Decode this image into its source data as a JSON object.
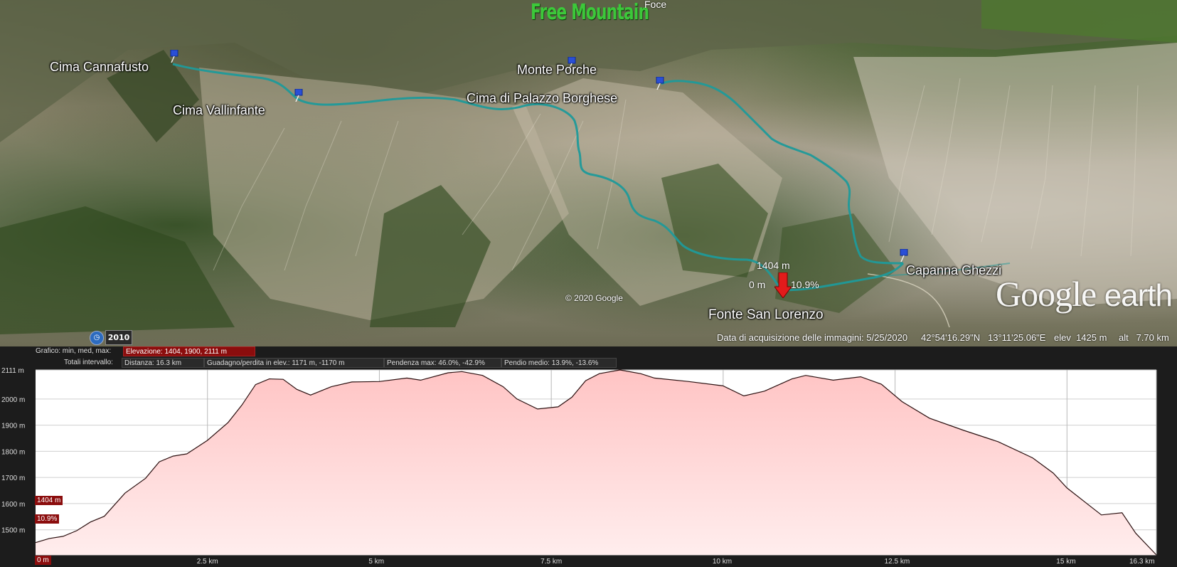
{
  "map": {
    "brand": "Free Mountain",
    "top_label": "Foce",
    "places": [
      {
        "id": "cima-cannafusto",
        "name": "Cima Cannafusto"
      },
      {
        "id": "cima-vallinfante",
        "name": "Cima Vallinfante"
      },
      {
        "id": "monte-porche",
        "name": "Monte Porche"
      },
      {
        "id": "cima-palazzo-borghese",
        "name": "Cima di Palazzo Borghese"
      },
      {
        "id": "capanna-ghezzi",
        "name": "Capanna Ghezzi"
      },
      {
        "id": "fonte-san-lorenzo",
        "name": "Fonte San Lorenzo"
      }
    ],
    "cursor": {
      "elevation": "1404 m",
      "distance": "0 m",
      "slope": "10.9%"
    },
    "copyright": "© 2020 Google",
    "watermark_google": "Google",
    "watermark_earth": "earth",
    "track_color": "#1f9a9a",
    "marker_color": "#e31b1b"
  },
  "statusbar": {
    "historical_icon": "clock-icon",
    "year": "2010",
    "acquisition": "Data di acquisizione delle immagini: 5/25/2020",
    "lat": "42°54'16.29\"N",
    "lon": "13°11'25.06\"E",
    "elev": "elev  1425 m",
    "alt": "alt   7.70 km"
  },
  "profile": {
    "row1_title": "Grafico: min, med, max:",
    "row1_value": "Elevazione: 1404, 1900, 2111 m",
    "row2_title": "Totali intervallo:",
    "distance": "Distanza: 16.3 km",
    "gain_loss": "Guadagno/perdita in elev.: 1171 m, -1170 m",
    "max_slope": "Pendenza max: 46.0%, -42.9%",
    "avg_slope": "Pendio medio: 13.9%, -13.6%",
    "current_elev": "1404 m",
    "current_slope": "10.9%",
    "current_dist": "0 m",
    "fill_top": "#ffc4c4",
    "fill_bottom": "#ffeded",
    "line_color": "#2b1010"
  },
  "chart_data": {
    "type": "area",
    "xlabel": "",
    "ylabel": "",
    "xlim": [
      0,
      16.3
    ],
    "ylim": [
      1404,
      2111
    ],
    "ytick_values": [
      1404,
      1500,
      1600,
      1700,
      1800,
      1900,
      2000,
      2111
    ],
    "ytick_labels": [
      "1404 m",
      "1500 m",
      "1600 m",
      "1700 m",
      "1800 m",
      "1900 m",
      "2000 m",
      "2111 m"
    ],
    "xtick_values": [
      2.5,
      5,
      7.5,
      10,
      12.5,
      15,
      16.3
    ],
    "xtick_labels": [
      "2.5 km",
      "5 km",
      "7.5 km",
      "10 km",
      "12.5 km",
      "15 km",
      "16.3 km"
    ],
    "grid": true,
    "series": [
      {
        "x": [
          0,
          0.2,
          0.4,
          0.6,
          0.8,
          1.0,
          1.3,
          1.6,
          1.8,
          2.0,
          2.2,
          2.5,
          2.8,
          3.0,
          3.2,
          3.4,
          3.6,
          3.8,
          4.0,
          4.3,
          4.6,
          5.0,
          5.4,
          5.6,
          6.0,
          6.2,
          6.5,
          6.8,
          7.0,
          7.3,
          7.6,
          7.8,
          8.0,
          8.2,
          8.5,
          8.8,
          9.0,
          9.5,
          10.0,
          10.3,
          10.6,
          11.0,
          11.2,
          11.6,
          12.0,
          12.3,
          12.6,
          13.0,
          13.5,
          14.0,
          14.5,
          14.8,
          15.0,
          15.5,
          15.8,
          16.0,
          16.3
        ],
        "y": [
          1451,
          1470,
          1475,
          1500,
          1530,
          1555,
          1640,
          1700,
          1760,
          1785,
          1790,
          1845,
          1910,
          1980,
          2055,
          2080,
          2075,
          2040,
          2015,
          2050,
          2065,
          2070,
          2080,
          2075,
          2100,
          2108,
          2090,
          2050,
          2000,
          1965,
          1970,
          2010,
          2070,
          2100,
          2111,
          2100,
          2080,
          2070,
          2050,
          2015,
          2030,
          2080,
          2090,
          2075,
          2085,
          2060,
          1990,
          1930,
          1880,
          1840,
          1775,
          1720,
          1660,
          1560,
          1565,
          1490,
          1404
        ]
      }
    ]
  }
}
